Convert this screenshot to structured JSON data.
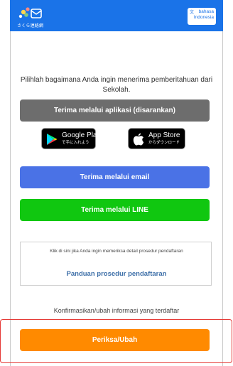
{
  "header": {
    "logo_text": "さくら連絡網",
    "language_label_line1": "bahasa",
    "language_label_line2": "Indonesia",
    "language_icon": "translate-icon"
  },
  "intro": {
    "text": "Pilihlah bagaimana Anda ingin menerima pemberitahuan dari Sekolah."
  },
  "buttons": {
    "app": "Terima melalui aplikasi (disarankan)",
    "email": "Terima melalui email",
    "line": "Terima melalui LINE",
    "check": "Periksa/Ubah"
  },
  "stores": {
    "google": {
      "name": "Google Play",
      "sub": "で手に入れよう",
      "icon": "google-play-icon"
    },
    "apple": {
      "name": "App Store",
      "sub": "からダウンロード",
      "icon": "apple-icon"
    }
  },
  "guide": {
    "note": "Klik di sini jika Anda ingin memeriksa detail prosedur pendaftaran",
    "link": "Panduan prosedur pendaftaran"
  },
  "confirm": {
    "text": "Konfirmasikan/ubah informasi yang terdaftar"
  },
  "colors": {
    "header": "#1a73e8",
    "app_button": "#6d6d6d",
    "email_button": "#4a72e6",
    "line_button": "#10c710",
    "check_button": "#ff8a00",
    "highlight": "#e53935"
  }
}
